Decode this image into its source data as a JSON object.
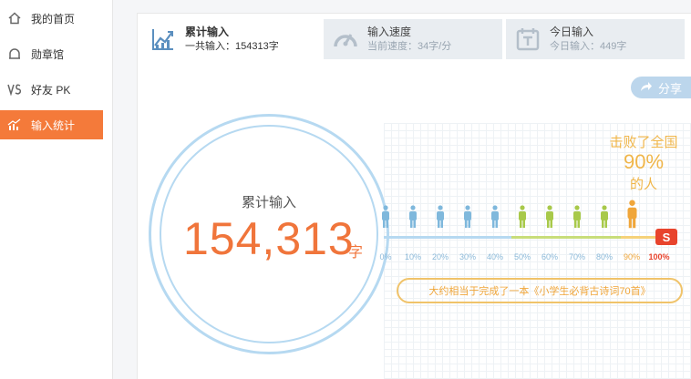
{
  "sidebar": {
    "items": [
      {
        "label": "我的首页",
        "icon": "home-icon",
        "active": false
      },
      {
        "label": "勋章馆",
        "icon": "medal-icon",
        "active": false
      },
      {
        "label": "好友 PK",
        "icon": "vs-icon",
        "active": false
      },
      {
        "label": "输入统计",
        "icon": "chart-icon",
        "active": true
      }
    ]
  },
  "tabs": [
    {
      "title": "累计输入",
      "sub": "一共输入：154313字",
      "icon": "line-chart-icon"
    },
    {
      "title": "输入速度",
      "sub": "当前速度：34字/分",
      "icon": "speedometer-icon"
    },
    {
      "title": "今日输入",
      "sub": "今日输入：449字",
      "icon": "calendar-icon"
    }
  ],
  "share_label": "分享",
  "total": {
    "label": "累计输入",
    "number": "154,313",
    "unit": "字"
  },
  "beat": {
    "title": "击败了全国",
    "percent": "90%",
    "tail": "的人",
    "value": 0.9
  },
  "scale": {
    "ticks": [
      "0%",
      "10%",
      "20%",
      "30%",
      "40%",
      "50%",
      "60%",
      "70%",
      "80%",
      "90%",
      "100%"
    ]
  },
  "equivalent_text": "大约相当于完成了一本《小学生必背古诗词70首》",
  "colors": {
    "accent": "#f47a3a",
    "ring": "#b6d9f1",
    "gold": "#f0b64a",
    "blue_person": "#7fb8dc",
    "green_person": "#a8c94a",
    "highlight_person": "#f0a63a"
  }
}
